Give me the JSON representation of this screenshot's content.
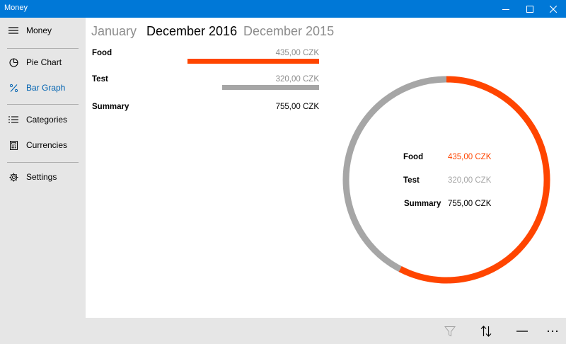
{
  "window": {
    "title": "Money"
  },
  "sidebar": {
    "header_label": "Money",
    "items": [
      {
        "label": "Pie Chart",
        "icon": "pie-chart-icon",
        "active": false
      },
      {
        "label": "Bar Graph",
        "icon": "percent-icon",
        "active": true
      },
      {
        "label": "Categories",
        "icon": "list-icon",
        "active": false
      },
      {
        "label": "Currencies",
        "icon": "calculator-icon",
        "active": false
      },
      {
        "label": "Settings",
        "icon": "gear-icon",
        "active": false
      }
    ]
  },
  "pivot": {
    "tabs": [
      {
        "label": "January",
        "selected": false
      },
      {
        "label": "December 2016",
        "selected": true
      },
      {
        "label": "December 2015",
        "selected": false
      }
    ]
  },
  "bar_list": {
    "rows": [
      {
        "name": "Food",
        "value_text": "435,00 CZK",
        "amount": 435.0,
        "color": "#ff4500"
      },
      {
        "name": "Test",
        "value_text": "320,00 CZK",
        "amount": 320.0,
        "color": "#a6a6a6"
      }
    ],
    "summary": {
      "name": "Summary",
      "value_text": "755,00 CZK"
    }
  },
  "donut": {
    "items": [
      {
        "name": "Food",
        "value_text": "435,00 CZK",
        "amount": 435.0,
        "color": "#ff4500"
      },
      {
        "name": "Test",
        "value_text": "320,00 CZK",
        "amount": 320.0,
        "color": "#a6a6a6"
      }
    ],
    "summary": {
      "name": "Summary",
      "value_text": "755,00 CZK"
    }
  },
  "chart_data": {
    "type": "pie",
    "categories": [
      "Food",
      "Test"
    ],
    "values": [
      435.0,
      320.0
    ],
    "colors": [
      "#ff4500",
      "#a6a6a6"
    ],
    "title": "",
    "total": 755.0,
    "unit": "CZK"
  },
  "command_bar": {
    "buttons": [
      {
        "icon": "filter-icon",
        "enabled": false
      },
      {
        "icon": "sort-icon",
        "enabled": true
      },
      {
        "icon": "minus-icon",
        "enabled": true
      },
      {
        "icon": "more-icon",
        "enabled": true
      }
    ]
  },
  "colors": {
    "accent": "#0078d7",
    "food": "#ff4500",
    "test": "#a6a6a6"
  }
}
